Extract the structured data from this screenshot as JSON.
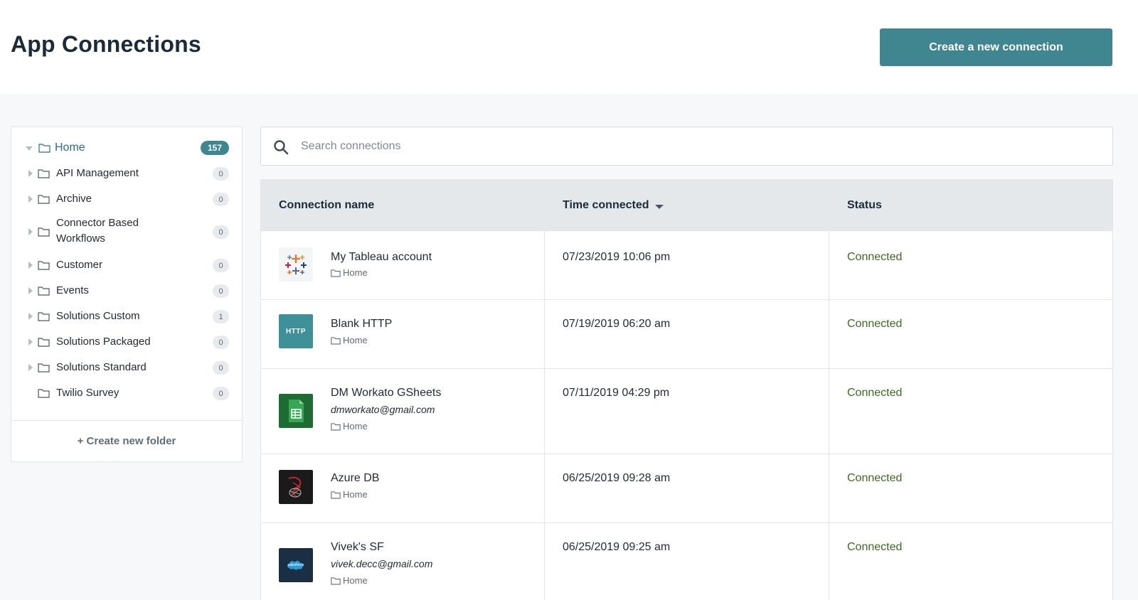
{
  "header": {
    "title": "App Connections",
    "create_button": "Create a new connection"
  },
  "sidebar": {
    "home": {
      "label": "Home",
      "count": "157"
    },
    "folders": [
      {
        "label": "API Management",
        "count": "0"
      },
      {
        "label": "Archive",
        "count": "0"
      },
      {
        "label": "Connector Based Workflows",
        "count": "0"
      },
      {
        "label": "Customer",
        "count": "0"
      },
      {
        "label": "Events",
        "count": "0"
      },
      {
        "label": "Solutions Custom",
        "count": "1"
      },
      {
        "label": "Solutions Packaged",
        "count": "0"
      },
      {
        "label": "Solutions Standard",
        "count": "0"
      },
      {
        "label": "Twilio Survey",
        "count": "0"
      }
    ],
    "create_folder": "+ Create new folder"
  },
  "search": {
    "placeholder": "Search connections",
    "value": ""
  },
  "table": {
    "headers": {
      "name": "Connection name",
      "time": "Time connected",
      "status": "Status"
    },
    "rows": [
      {
        "name": "My Tableau account",
        "email": "",
        "folder": "Home",
        "time": "07/23/2019 10:06 pm",
        "status": "Connected",
        "icon": "tableau-logo"
      },
      {
        "name": "Blank HTTP",
        "email": "",
        "folder": "Home",
        "time": "07/19/2019 06:20 am",
        "status": "Connected",
        "icon": "http-logo",
        "icon_text": "HTTP"
      },
      {
        "name": "DM Workato GSheets",
        "email": "dmworkato@gmail.com",
        "folder": "Home",
        "time": "07/11/2019 04:29 pm",
        "status": "Connected",
        "icon": "google-sheets-logo"
      },
      {
        "name": "Azure DB",
        "email": "",
        "folder": "Home",
        "time": "06/25/2019 09:28 am",
        "status": "Connected",
        "icon": "sql-server-logo"
      },
      {
        "name": "Vivek's SF",
        "email": "vivek.decc@gmail.com",
        "folder": "Home",
        "time": "06/25/2019 09:25 am",
        "status": "Connected",
        "icon": "salesforce-logo",
        "icon_text": "salesforce"
      }
    ]
  },
  "colors": {
    "accent": "#3f8690",
    "status_connected": "#3d6b1f",
    "header_bg": "#e4e8eb"
  }
}
